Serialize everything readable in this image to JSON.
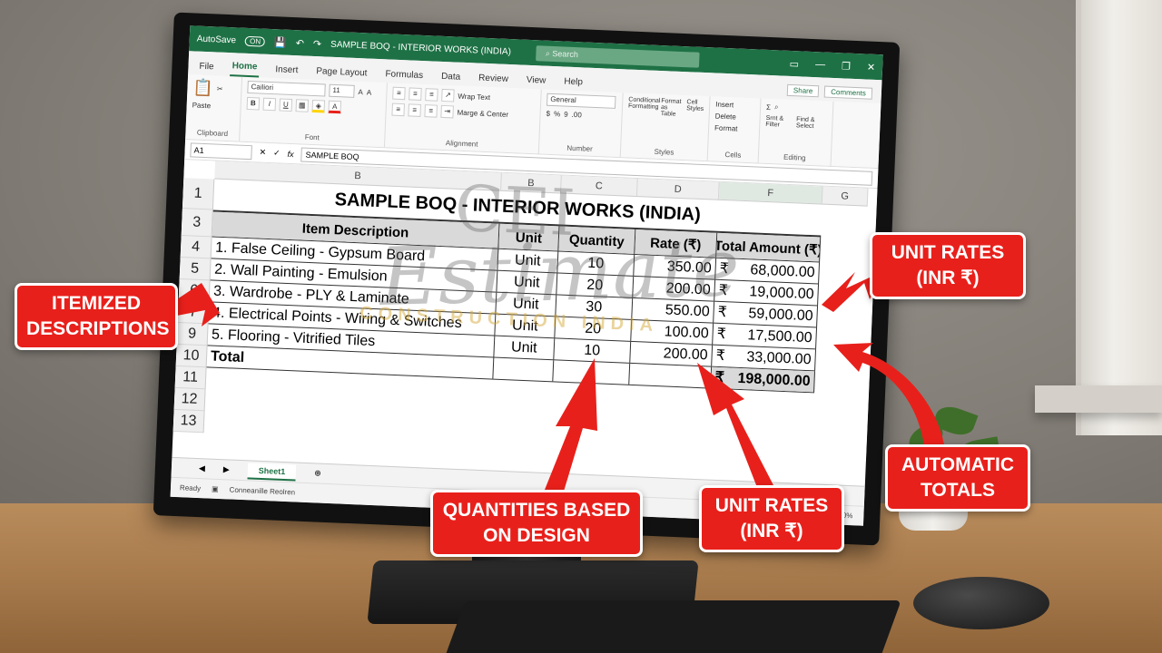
{
  "excel": {
    "autosave_label": "AutoSave",
    "autosave_state": "ON",
    "window_title": "SAMPLE BOQ - INTERIOR WORKS (INDIA)",
    "search_placeholder": "Search",
    "tabs": [
      "File",
      "Home",
      "Insert",
      "Page Layout",
      "Formulas",
      "Data",
      "Review",
      "View",
      "Help"
    ],
    "active_tab": "Home",
    "share_label": "Share",
    "comments_label": "Comments",
    "ribbon": {
      "clipboard": {
        "paste": "Paste",
        "label": "Clipboard"
      },
      "font": {
        "name": "Cailiori",
        "size": "11",
        "label": "Font"
      },
      "alignment": {
        "wrap": "Wrap Text",
        "merge": "Marge & Center",
        "label": "Alignment"
      },
      "number": {
        "format": "General",
        "label": "Number"
      },
      "styles": {
        "conditional": "Conditional Formatting",
        "format_as": "Format as Table",
        "cell_styles": "Cell Styles",
        "label": "Styles"
      },
      "cells": {
        "insert": "Insert",
        "delete": "Delete",
        "format": "Format",
        "label": "Cells"
      },
      "editing": {
        "sort": "Srnt & Filter",
        "find": "Find & Select",
        "label": "Editing"
      }
    },
    "name_box": "A1",
    "formula_value": "SAMPLE BOQ",
    "columns": [
      "B",
      "B",
      "C",
      "D",
      "F",
      "G"
    ],
    "rows": [
      "1",
      "3",
      "4",
      "5",
      "6",
      "7",
      "9",
      "10",
      "11",
      "12",
      "13"
    ],
    "sheet_tab": "Sheet1",
    "status_ready": "Ready",
    "status_text": "Conneanille Reolren",
    "zoom": "100%"
  },
  "boq": {
    "title": "SAMPLE BOQ - INTERIOR WORKS (INDIA)",
    "headers": {
      "desc": "Item Description",
      "unit": "Unit",
      "qty": "Quantity",
      "rate": "Rate (₹)",
      "amount": "Total Amount (₹)"
    },
    "currency": "₹",
    "items": [
      {
        "desc": "1. False Ceiling - Gypsum Board",
        "unit": "Unit",
        "qty": "10",
        "rate": "350.00",
        "amount": "68,000.00"
      },
      {
        "desc": "2. Wall Painting - Emulsion",
        "unit": "Unit",
        "qty": "20",
        "rate": "200.00",
        "amount": "19,000.00"
      },
      {
        "desc": "3. Wardrobe - PLY & Laminate",
        "unit": "Unit",
        "qty": "30",
        "rate": "550.00",
        "amount": "59,000.00"
      },
      {
        "desc": "4. Electrical Points - Wiring & Switches",
        "unit": "Unit",
        "qty": "20",
        "rate": "100.00",
        "amount": "17,500.00"
      },
      {
        "desc": "5. Flooring - Vitrified Tiles",
        "unit": "Unit",
        "qty": "10",
        "rate": "200.00",
        "amount": "33,000.00"
      }
    ],
    "grand_total": "198,000.00",
    "total_label": "Total"
  },
  "watermark": {
    "logo": "CEI",
    "script": "Estimate",
    "sub": "CONSTRUCTION INDIA"
  },
  "callouts": {
    "itemized": "ITEMIZED DESCRIPTIONS",
    "unit_rates_top": "UNIT RATES (INR ₹)",
    "quantities": "QUANTITIES BASED ON DESIGN",
    "unit_rates_bottom": "UNIT RATES (INR ₹)",
    "totals": "AUTOMATIC TOTALS"
  },
  "colors": {
    "excel_green": "#1e7145",
    "callout_red": "#e8201b"
  }
}
